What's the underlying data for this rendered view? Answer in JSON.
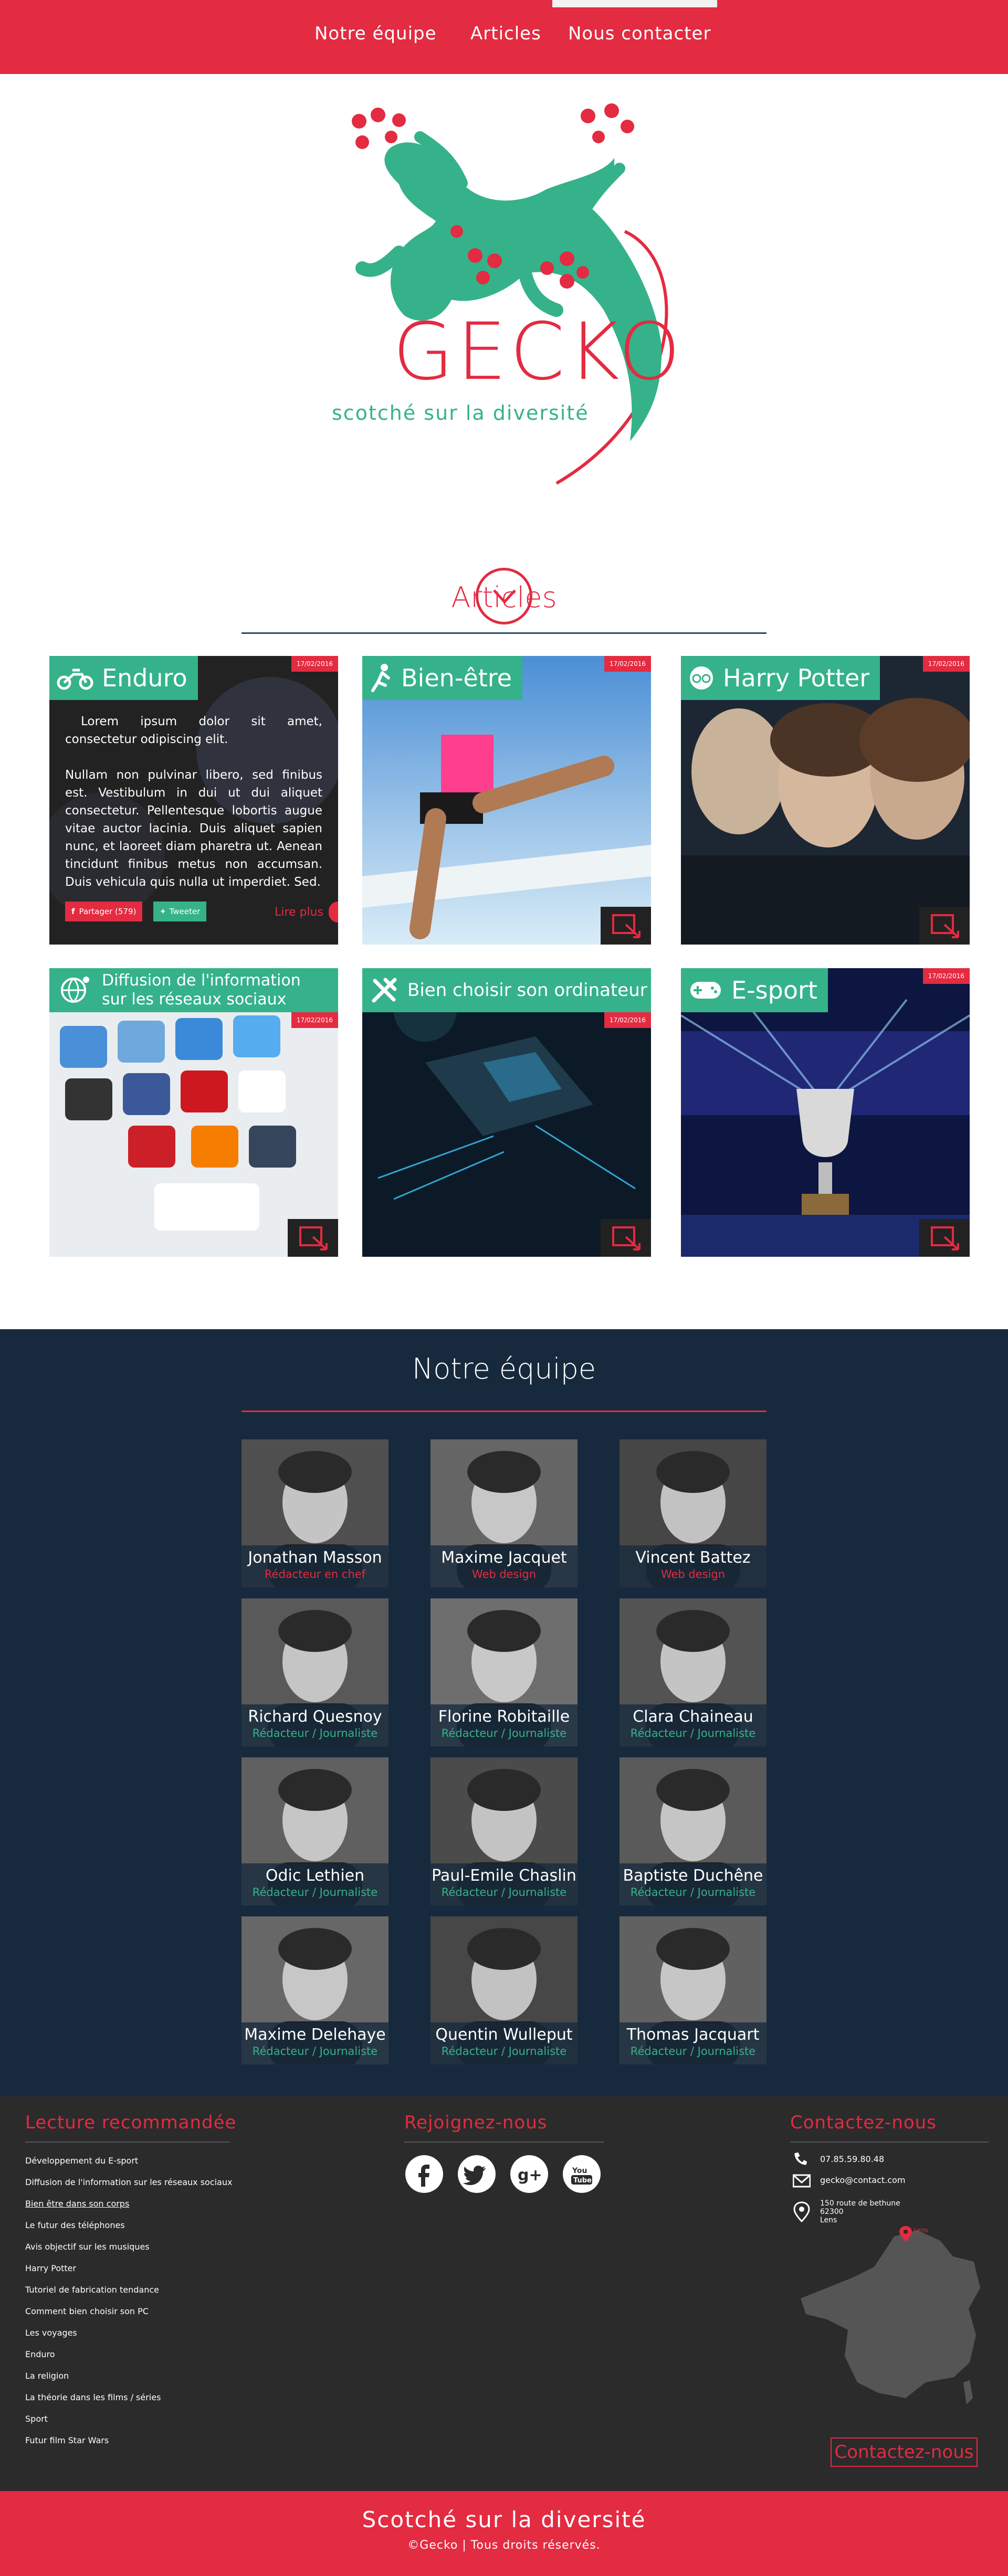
{
  "nav": {
    "links": [
      "Notre équipe",
      "Articles",
      "Nous contacter"
    ]
  },
  "brand": {
    "name": "GECKO",
    "tagline": "scotché sur la diversité"
  },
  "articles": {
    "title": "Articles",
    "cards": [
      {
        "title": "Enduro",
        "date": "17/02/2016",
        "icon": "motorbike-icon",
        "text": [
          "Lorem ipsum dolor sit amet, consectetur odipiscing elit.",
          "Nullam non pulvinar libero, sed finibus est. Vestibulum in dui ut dui aliquet consectetur. Pellentesque lobortis augue vitae auctor lacinia. Duis aliquet sapien nunc, et laoreet diam pharetra ut. Aenean tincidunt finibus metus non accumsan. Duis vehicula quis nulla ut imperdiet. Sed."
        ],
        "share": [
          "Partager (579)",
          "Tweeter"
        ],
        "read_more": "Lire plus"
      },
      {
        "title": "Bien-être",
        "date": "17/02/2016",
        "icon": "runner-icon"
      },
      {
        "title": "Harry Potter",
        "date": "17/02/2016",
        "icon": "glasses-icon"
      },
      {
        "title": "Diffusion de l'information sur les réseaux sociaux",
        "date": "17/02/2016",
        "icon": "network-globe-icon"
      },
      {
        "title": "Bien choisir son ordinateur",
        "date": "17/02/2016",
        "icon": "tools-icon"
      },
      {
        "title": "E-sport",
        "date": "17/02/2016",
        "icon": "gamepad-icon"
      }
    ]
  },
  "team": {
    "title": "Notre équipe",
    "members": [
      {
        "name": "Jonathan Masson",
        "role": "Rédacteur en chef",
        "role_color": "#e32b41"
      },
      {
        "name": "Maxime Jacquet",
        "role": "Web design",
        "role_color": "#e32b41"
      },
      {
        "name": "Vincent Battez",
        "role": "Web design",
        "role_color": "#e32b41"
      },
      {
        "name": "Richard Quesnoy",
        "role": "Rédacteur / Journaliste",
        "role_color": "#35b28a"
      },
      {
        "name": "Florine Robitaille",
        "role": "Rédacteur / Journaliste",
        "role_color": "#35b28a"
      },
      {
        "name": "Clara Chaineau",
        "role": "Rédacteur / Journaliste",
        "role_color": "#35b28a"
      },
      {
        "name": "Odic Lethien",
        "role": "Rédacteur / Journaliste",
        "role_color": "#35b28a"
      },
      {
        "name": "Paul-Emile Chaslin",
        "role": "Rédacteur / Journaliste",
        "role_color": "#35b28a"
      },
      {
        "name": "Baptiste Duchêne",
        "role": "Rédacteur / Journaliste",
        "role_color": "#35b28a"
      },
      {
        "name": "Maxime Delehaye",
        "role": "Rédacteur / Journaliste",
        "role_color": "#35b28a"
      },
      {
        "name": "Quentin Wulleput",
        "role": "Rédacteur / Journaliste",
        "role_color": "#35b28a"
      },
      {
        "name": "Thomas Jacquart",
        "role": "Rédacteur / Journaliste",
        "role_color": "#35b28a"
      }
    ]
  },
  "footer": {
    "recommended": {
      "title": "Lecture recommandée",
      "links": [
        "Développement du E-sport",
        "Diffusion de l'information sur les réseaux sociaux",
        "Bien être dans son corps",
        "Le futur des téléphones",
        "Avis objectif sur les musiques",
        "Harry Potter",
        "Tutoriel de fabrication tendance",
        "Comment bien choisir son PC",
        "Les voyages",
        "Enduro",
        "La religion",
        "La théorie dans les films / séries",
        "Sport",
        "Futur film Star Wars"
      ]
    },
    "social": {
      "title": "Rejoignez-nous",
      "icons": [
        "facebook-icon",
        "twitter-icon",
        "google-plus-icon",
        "youtube-icon"
      ]
    },
    "contact": {
      "title": "Contactez-nous",
      "phone": "07.85.59.80.48",
      "email": "gecko@contact.com",
      "address": [
        "150 route de bethune",
        "62300",
        "Lens"
      ],
      "map_label": "Lens",
      "button": "Contactez-nous"
    }
  },
  "bottom": {
    "slogan": "Scotché sur la diversité",
    "copyright": "©Gecko | Tous droits réservés."
  },
  "colors": {
    "brand_red": "#e32b41",
    "brand_green": "#35b28a",
    "team_bg": "#172a3d",
    "footer_bg": "#2b2b2b"
  }
}
